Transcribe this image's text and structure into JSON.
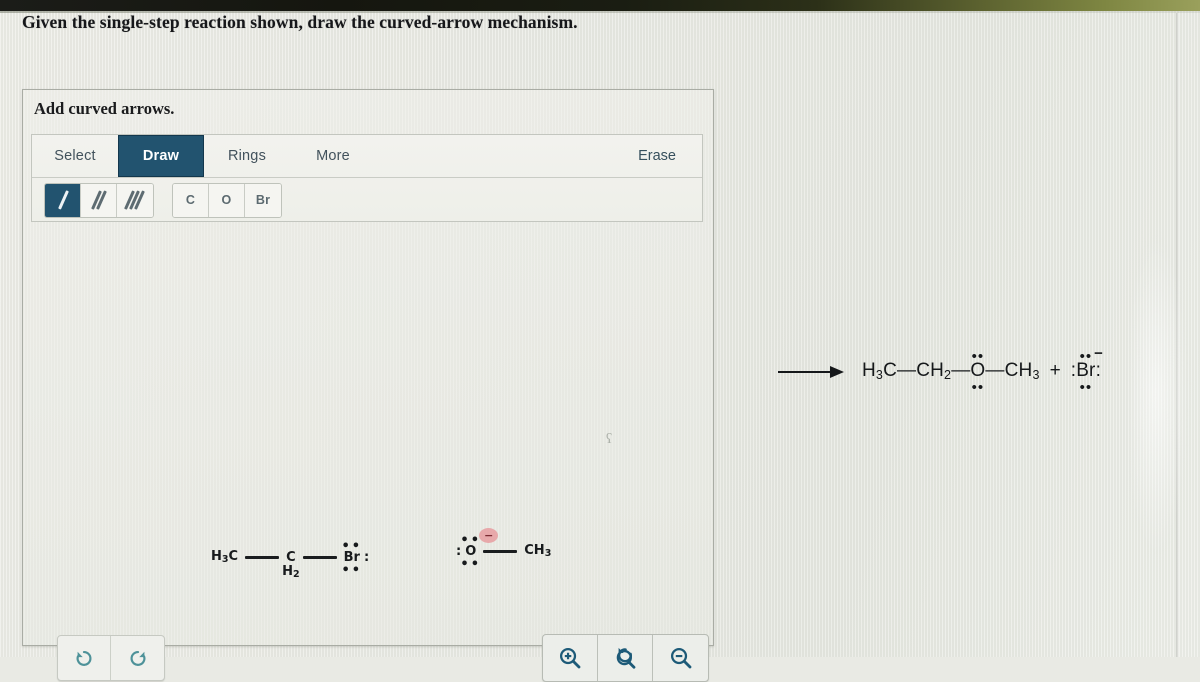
{
  "prompt": "Given the single-step reaction shown, draw the curved-arrow mechanism.",
  "panel": {
    "title": "Add curved arrows.",
    "tabs": [
      {
        "label": "Select",
        "active": false
      },
      {
        "label": "Draw",
        "active": true
      },
      {
        "label": "Rings",
        "active": false
      },
      {
        "label": "More",
        "active": false
      }
    ],
    "erase_label": "Erase",
    "bond_tools": [
      {
        "name": "single-bond",
        "selected": true
      },
      {
        "name": "double-bond",
        "selected": false
      },
      {
        "name": "triple-bond",
        "selected": false
      }
    ],
    "element_tools": [
      {
        "label": "C",
        "selected": false
      },
      {
        "label": "O",
        "selected": false
      },
      {
        "label": "Br",
        "selected": false
      }
    ],
    "history_buttons": [
      {
        "name": "undo-button",
        "icon": "undo-icon"
      },
      {
        "name": "redo-button",
        "icon": "redo-icon"
      }
    ],
    "zoom_buttons": [
      {
        "name": "zoom-in-button",
        "icon": "magnifier-plus-icon"
      },
      {
        "name": "zoom-reset-button",
        "icon": "magnifier-reset-icon"
      },
      {
        "name": "zoom-out-button",
        "icon": "magnifier-minus-icon"
      }
    ],
    "canvas_artifact": "ʕ"
  },
  "reaction": {
    "reactant_bromide": {
      "a1": "H",
      "a1_sub": "3",
      "a1_tail": "C",
      "a2": "C",
      "a2_under": "H",
      "a2_under_sub": "2",
      "a3": "Br",
      "lone_pair_top": "••",
      "lone_pair_bottom": "••",
      "lone_pair_right": ":"
    },
    "reactant_methoxide": {
      "lone_pair_left": ":",
      "atom_o": "O",
      "lone_pair_top": "••",
      "lone_pair_bottom": "••",
      "charge": "−",
      "atom_c": "CH",
      "atom_c_sub": "3"
    },
    "arrow": "reaction-arrow",
    "product_ether": {
      "p1": "H",
      "p1_sub": "3",
      "p1_tail": "C",
      "dash1": "—",
      "p2": "CH",
      "p2_sub": "2",
      "dash2": "—",
      "p3": "O",
      "o_dots_top": "••",
      "o_dots_bottom": "••",
      "dash3": "—",
      "p4": "CH",
      "p4_sub": "3"
    },
    "plus": "+",
    "product_bromide": {
      "lead_colon": ":",
      "atom": "Br",
      "trail_colon": ":",
      "dots_top": "••",
      "dots_bottom": "••",
      "charge": "−"
    }
  },
  "colors": {
    "accent_navy": "#22536f",
    "panel_border": "#a9aca4",
    "page_bg": "#e9eae4",
    "charge_highlight": "#e7969a",
    "undo_teal": "#4e9299"
  }
}
